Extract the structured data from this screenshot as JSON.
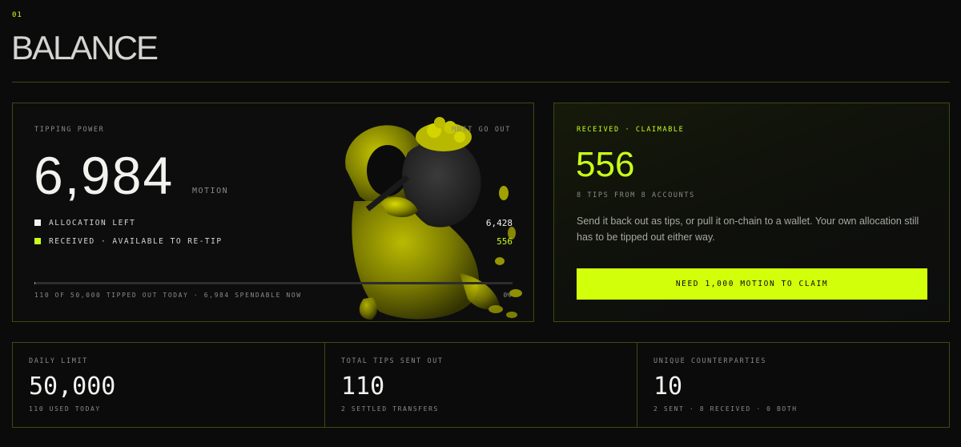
{
  "header": {
    "section_number": "01",
    "title": "BALANCE"
  },
  "power": {
    "label": "TIPPING POWER",
    "badge": "MUST GO OUT",
    "value": "6,984",
    "unit": "MOTION",
    "rows": [
      {
        "label": "ALLOCATION LEFT",
        "value": "6,428",
        "color": "#f2f2ee"
      },
      {
        "label": "RECEIVED · AVAILABLE TO RE-TIP",
        "value": "556",
        "color": "#c8ff1a"
      }
    ],
    "progress_note": "110 OF 50,000 TIPPED OUT TODAY · 6,984 SPENDABLE NOW",
    "progress_percent_label": "0%",
    "progress_fraction": 0.0022,
    "illustration": "hooded-figure-with-coin-sack"
  },
  "claim": {
    "label": "RECEIVED · CLAIMABLE",
    "value": "556",
    "sub": "8 TIPS FROM 8 ACCOUNTS",
    "description": "Send it back out as tips, or pull it on-chain to a wallet. Your own allocation still has to be tipped out either way.",
    "button": "NEED 1,000 MOTION TO CLAIM"
  },
  "stats": [
    {
      "label": "DAILY LIMIT",
      "value": "50,000",
      "sub": "110 USED TODAY"
    },
    {
      "label": "TOTAL TIPS SENT OUT",
      "value": "110",
      "sub": "2 SETTLED TRANSFERS"
    },
    {
      "label": "UNIQUE COUNTERPARTIES",
      "value": "10",
      "sub": "2 SENT · 8 RECEIVED · 0 BOTH"
    }
  ],
  "colors": {
    "accent": "#c8ff1a",
    "background": "#0b0b0c",
    "border": "#3d4a12"
  }
}
